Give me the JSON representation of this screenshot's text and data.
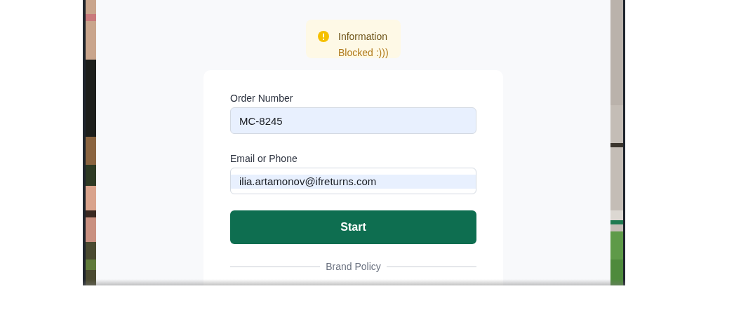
{
  "alert": {
    "title": "Information",
    "message": "Blocked :)))"
  },
  "fields": [
    {
      "label": "Order Number",
      "value": "MC-8245",
      "kind": "autofilled"
    },
    {
      "label": "Email or Phone",
      "value": "ilia.artamonov@ifreturns.com",
      "kind": "highlighted"
    }
  ],
  "button": {
    "label": "Start"
  },
  "divider": {
    "label": "Brand Policy"
  }
}
